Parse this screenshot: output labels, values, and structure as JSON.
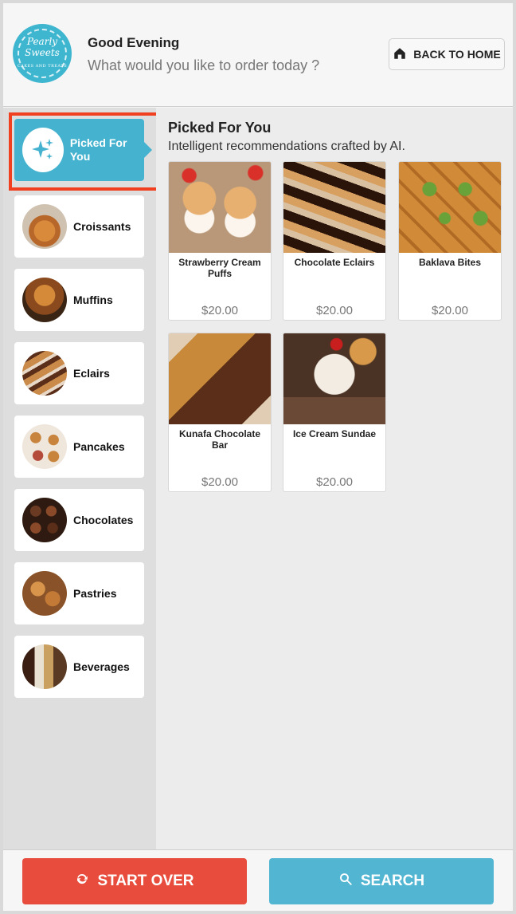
{
  "header": {
    "logo_text": "Pearly Sweets",
    "logo_subtext": "CAKES AND TREATS",
    "greeting": "Good Evening",
    "prompt": "What would you like to order today ?",
    "back_label": "BACK TO HOME"
  },
  "sidebar": {
    "items": [
      {
        "label": "Picked For You",
        "active": true,
        "icon": "sparkle-icon"
      },
      {
        "label": "Croissants",
        "active": false
      },
      {
        "label": "Muffins",
        "active": false
      },
      {
        "label": "Eclairs",
        "active": false
      },
      {
        "label": "Pancakes",
        "active": false
      },
      {
        "label": "Chocolates",
        "active": false
      },
      {
        "label": "Pastries",
        "active": false
      },
      {
        "label": "Beverages",
        "active": false
      }
    ]
  },
  "main": {
    "title": "Picked For You",
    "subtitle": "Intelligent recommendations crafted by AI.",
    "products": [
      {
        "name": "Strawberry Cream Puffs",
        "price": "$20.00"
      },
      {
        "name": "Chocolate Eclairs",
        "price": "$20.00"
      },
      {
        "name": "Baklava Bites",
        "price": "$20.00"
      },
      {
        "name": "Kunafa Chocolate Bar",
        "price": "$20.00"
      },
      {
        "name": "Ice Cream Sundae",
        "price": "$20.00"
      }
    ]
  },
  "footer": {
    "start_over_label": "START OVER",
    "search_label": "SEARCH"
  },
  "colors": {
    "accent": "#45b3cf",
    "start_over": "#e84c3d",
    "search": "#52b6d3",
    "selection_outline": "#f0401f"
  }
}
